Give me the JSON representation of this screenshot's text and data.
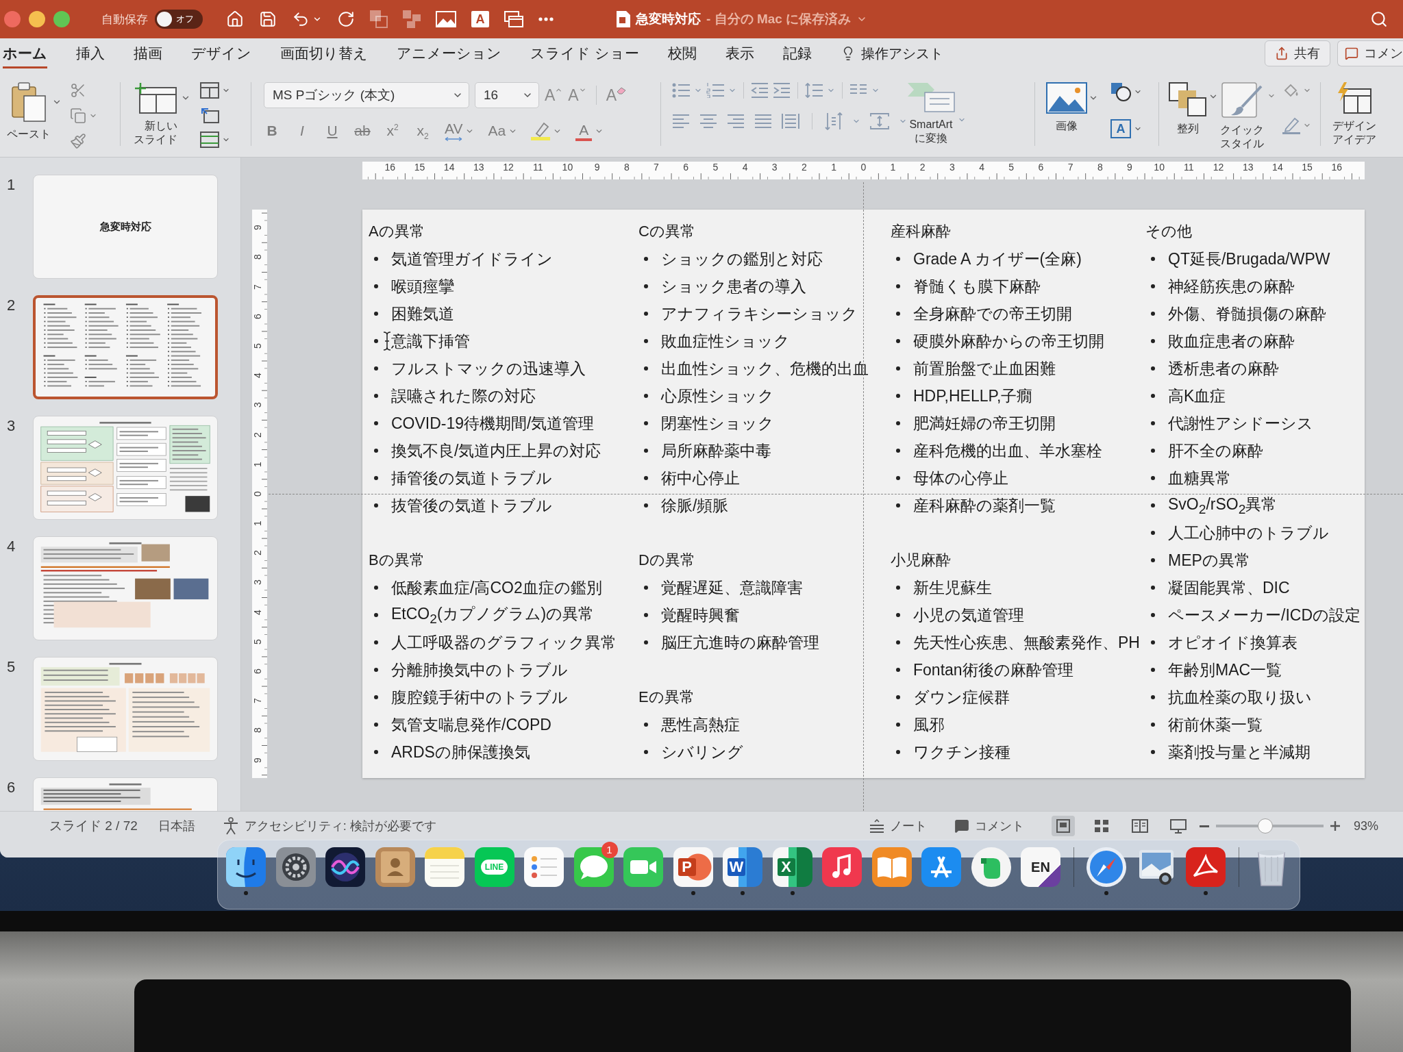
{
  "title_bar": {
    "autosave": {
      "label": "自動保存",
      "state_label": "オフ",
      "on": false
    },
    "quick_access": [
      {
        "kind": "home",
        "disabled": false
      },
      {
        "kind": "save",
        "disabled": false
      },
      {
        "kind": "undo",
        "disabled": false
      },
      {
        "kind": "redo",
        "disabled": false
      },
      {
        "kind": "bring_forward",
        "disabled": true
      },
      {
        "kind": "group",
        "disabled": true
      },
      {
        "kind": "picture",
        "disabled": false
      },
      {
        "kind": "text_box",
        "label": "A",
        "disabled": false
      },
      {
        "kind": "window",
        "disabled": false
      },
      {
        "kind": "more",
        "disabled": false
      }
    ],
    "document_title": "急変時対応",
    "save_status": "- 自分の Mac に保存済み"
  },
  "ribbon_tabs": [
    {
      "label": "ホーム",
      "selected": true
    },
    {
      "label": "挿入",
      "selected": false
    },
    {
      "label": "描画",
      "selected": false
    },
    {
      "label": "デザイン",
      "selected": false
    },
    {
      "label": "画面切り替え",
      "selected": false
    },
    {
      "label": "アニメーション",
      "selected": false
    },
    {
      "label": "スライド ショー",
      "selected": false
    },
    {
      "label": "校閲",
      "selected": false
    },
    {
      "label": "表示",
      "selected": false
    },
    {
      "label": "記録",
      "selected": false
    }
  ],
  "tell_me": "操作アシスト",
  "share_button": "共有",
  "comments_button": "コメン",
  "ribbon": {
    "paste_label": "ペースト",
    "new_slide_label": "新しいスライド",
    "font_name": "MS Pゴシック (本文)",
    "font_size": "16",
    "grow_font_label": "A",
    "shrink_font_label": "A",
    "clear_format_label": "A",
    "format_buttons": [
      {
        "kind": "bold",
        "label": "B"
      },
      {
        "kind": "italic",
        "label": "I"
      },
      {
        "kind": "underline",
        "label": "U"
      },
      {
        "kind": "strikethrough",
        "label": "ab"
      },
      {
        "kind": "superscript",
        "label": "x$^{2}$"
      },
      {
        "kind": "subscript",
        "label": "x$_{2}$"
      },
      {
        "kind": "spacing",
        "label": "AV"
      },
      {
        "kind": "case",
        "label": "Aa"
      },
      {
        "kind": "highlight"
      },
      {
        "kind": "font_color",
        "label": "A"
      }
    ],
    "smartart_label": "SmartArt\nに変換",
    "picture_label": "画像",
    "text_box_label": "A",
    "arrange_label": "整列",
    "quick_styles_label": "クイックスタイル",
    "design_ideas_label": "デザインアイデア"
  },
  "ruler": {
    "horizontal": [
      "16",
      "15",
      "14",
      "13",
      "12",
      "11",
      "10",
      "9",
      "8",
      "7",
      "6",
      "5",
      "4",
      "3",
      "2",
      "1",
      "0",
      "1",
      "2",
      "3",
      "4",
      "5",
      "6",
      "7",
      "8",
      "9",
      "10",
      "11",
      "12",
      "13",
      "14",
      "15",
      "16"
    ],
    "vertical": [
      "9",
      "8",
      "7",
      "6",
      "5",
      "4",
      "3",
      "2",
      "1",
      "0",
      "1",
      "2",
      "3",
      "4",
      "5",
      "6",
      "7",
      "8",
      "9"
    ]
  },
  "thumbnails": [
    {
      "number": "1",
      "kind": "title",
      "title": "急変時対応",
      "selected": false
    },
    {
      "number": "2",
      "kind": "columns",
      "selected": true
    },
    {
      "number": "3",
      "kind": "flowchart",
      "selected": false
    },
    {
      "number": "4",
      "kind": "photos",
      "selected": false
    },
    {
      "number": "5",
      "kind": "table",
      "selected": false
    },
    {
      "number": "6",
      "kind": "text",
      "selected": false
    }
  ],
  "slide": {
    "columns": [
      {
        "sections": [
          {
            "heading": "Aの異常",
            "items": [
              "気道管理ガイドライン",
              "喉頭痙攣",
              "困難気道",
              "意識下挿管",
              "フルストマックの迅速導入",
              "誤嚥された際の対応",
              "COVID-19待機期間/気道管理",
              "換気不良/気道内圧上昇の対応",
              "挿管後の気道トラブル",
              "抜管後の気道トラブル"
            ]
          },
          {
            "heading": "Bの異常",
            "items": [
              "低酸素血症/高CO2血症の鑑別",
              "EtCO$_{2}$(カプノグラム)の異常",
              "人工呼吸器のグラフィック異常",
              "分離肺換気中のトラブル",
              "腹腔鏡手術中のトラブル",
              "気管支喘息発作/COPD",
              "ARDSの肺保護換気"
            ]
          }
        ]
      },
      {
        "sections": [
          {
            "heading": "Cの異常",
            "items": [
              "ショックの鑑別と対応",
              "ショック患者の導入",
              "アナフィラキシーショック",
              "敗血症性ショック",
              "出血性ショック、危機的出血",
              "心原性ショック",
              "閉塞性ショック",
              "局所麻酔薬中毒",
              "術中心停止",
              "徐脈/頻脈"
            ]
          },
          {
            "heading": "Dの異常",
            "items": [
              "覚醒遅延、意識障害",
              "覚醒時興奮",
              "脳圧亢進時の麻酔管理"
            ]
          },
          {
            "heading": "Eの異常",
            "items": [
              "悪性高熱症",
              "シバリング"
            ]
          }
        ]
      },
      {
        "sections": [
          {
            "heading": "産科麻酔",
            "items": [
              "Grade A カイザー(全麻)",
              "脊髄くも膜下麻酔",
              "全身麻酔での帝王切開",
              "硬膜外麻酔からの帝王切開",
              "前置胎盤で止血困難",
              "HDP,HELLP,子癇",
              "肥満妊婦の帝王切開",
              "産科危機的出血、羊水塞栓",
              "母体の心停止",
              "産科麻酔の薬剤一覧"
            ]
          },
          {
            "heading": "小児麻酔",
            "items": [
              "新生児蘇生",
              "小児の気道管理",
              "先天性心疾患、無酸素発作、PH",
              "Fontan術後の麻酔管理",
              "ダウン症候群",
              "風邪",
              "ワクチン接種"
            ]
          }
        ]
      },
      {
        "sections": [
          {
            "heading": "その他",
            "items": [
              "QT延長/Brugada/WPW",
              "神経筋疾患の麻酔",
              "外傷、脊髄損傷の麻酔",
              "敗血症患者の麻酔",
              "透析患者の麻酔",
              "高K血症",
              "代謝性アシドーシス",
              "肝不全の麻酔",
              "血糖異常",
              "SvO$_{2}$/rSO$_{2}$異常",
              "人工心肺中のトラブル",
              "MEPの異常",
              "凝固能異常、DIC",
              "ペースメーカー/ICDの設定",
              "オピオイド換算表",
              "年齢別MAC一覧",
              "抗血栓薬の取り扱い",
              "術前休薬一覧",
              "薬剤投与量と半減期"
            ]
          }
        ]
      }
    ]
  },
  "status_bar": {
    "slide_position": "スライド 2 / 72",
    "language": "日本語",
    "accessibility": "アクセシビリティ: 検討が必要です",
    "notes_button": "ノート",
    "comments_button": "コメント",
    "views": [
      {
        "kind": "normal",
        "selected": true
      },
      {
        "kind": "sorter",
        "selected": false
      },
      {
        "kind": "reading",
        "selected": false
      },
      {
        "kind": "slideshow",
        "selected": false
      }
    ],
    "zoom": {
      "level": 0.46,
      "reading": "93%"
    }
  },
  "dock": {
    "apps": [
      {
        "kind": "finder",
        "running": true
      },
      {
        "kind": "system_preferences",
        "running": false
      },
      {
        "kind": "siri",
        "running": false
      },
      {
        "kind": "contacts",
        "running": false
      },
      {
        "kind": "notes",
        "running": false
      },
      {
        "kind": "line",
        "label": "LINE",
        "running": false
      },
      {
        "kind": "reminders",
        "running": false
      },
      {
        "kind": "messages",
        "badge": "1",
        "running": false
      },
      {
        "kind": "facetime",
        "running": false
      },
      {
        "kind": "powerpoint",
        "label": "P",
        "running": true
      },
      {
        "kind": "word",
        "label": "W",
        "running": true
      },
      {
        "kind": "excel",
        "label": "X",
        "running": true
      },
      {
        "kind": "music",
        "running": false
      },
      {
        "kind": "books",
        "running": false
      },
      {
        "kind": "app_store",
        "running": false
      },
      {
        "kind": "evernote",
        "running": false
      },
      {
        "kind": "dictionary",
        "label": "EN",
        "running": false
      },
      {
        "kind": "separator"
      },
      {
        "kind": "safari",
        "running": true
      },
      {
        "kind": "preview",
        "running": false
      },
      {
        "kind": "acrobat",
        "running": true
      },
      {
        "kind": "separator"
      },
      {
        "kind": "trash",
        "running": false
      }
    ]
  }
}
